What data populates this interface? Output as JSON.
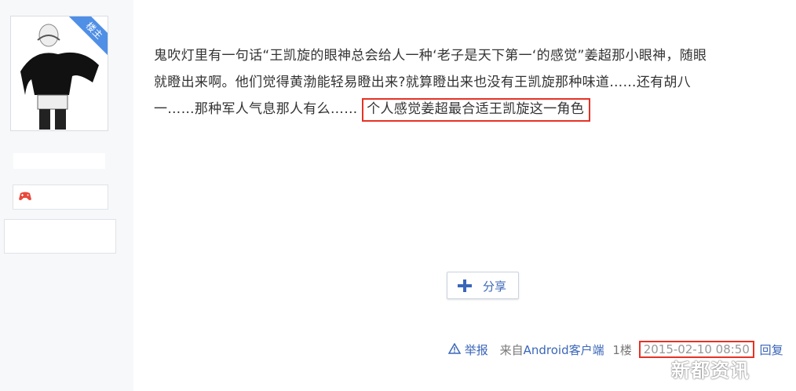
{
  "sidebar": {
    "badge": "楼主",
    "game_icon": "game-controller-icon"
  },
  "post": {
    "text_before": "鬼吹灯里有一句话“王凯旋的眼神总会给人一种‘老子是天下第一‘的感觉”姜超那小眼神，随眼\n就瞪出来啊。他们觉得黄渤能轻易瞪出来?就算瞪出来也没有王凯旋那种味道……还有胡八\n一……那种军人气息那人有么…… ",
    "highlight": "个人感觉姜超最合适王凯旋这一角色"
  },
  "share": {
    "label": "分享",
    "icon": "plus-icon"
  },
  "footer": {
    "report_label": "举报",
    "source_prefix": "来自",
    "source_client": "Android客户端",
    "floor": "1楼",
    "time": "2015-02-10 08:50",
    "reply_label": "回复"
  },
  "watermark": "新都资讯",
  "colors": {
    "highlight_border": "#e63225",
    "link": "#3a66b8",
    "badge": "#4f8fe6"
  }
}
